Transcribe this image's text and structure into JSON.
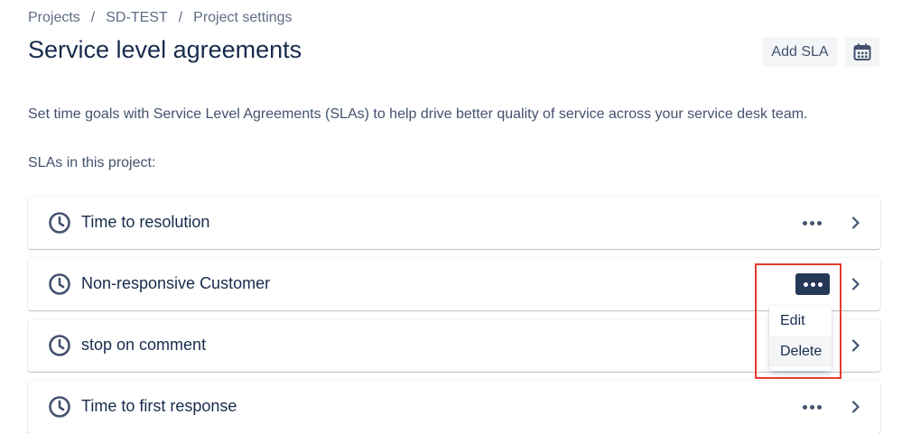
{
  "breadcrumb": {
    "items": [
      "Projects",
      "SD-TEST",
      "Project settings"
    ],
    "separator": "/"
  },
  "header": {
    "title": "Service level agreements",
    "add_sla_label": "Add SLA",
    "calendar_icon": "calendar-icon"
  },
  "description": "Set time goals with Service Level Agreements (SLAs) to help drive better quality of service across your service desk team.",
  "list_heading": "SLAs in this project:",
  "slas": [
    {
      "name": "Time to resolution"
    },
    {
      "name": "Non-responsive Customer",
      "menu_open": true
    },
    {
      "name": "stop on comment"
    },
    {
      "name": "Time to first response"
    }
  ],
  "context_menu": {
    "items": [
      "Edit",
      "Delete"
    ],
    "hovered": "Delete"
  },
  "colors": {
    "text_primary": "#172B4D",
    "text_secondary": "#42526E",
    "button_bg": "#F4F5F7",
    "active_more_bg": "#253858",
    "highlight_border": "#E53B2C"
  }
}
